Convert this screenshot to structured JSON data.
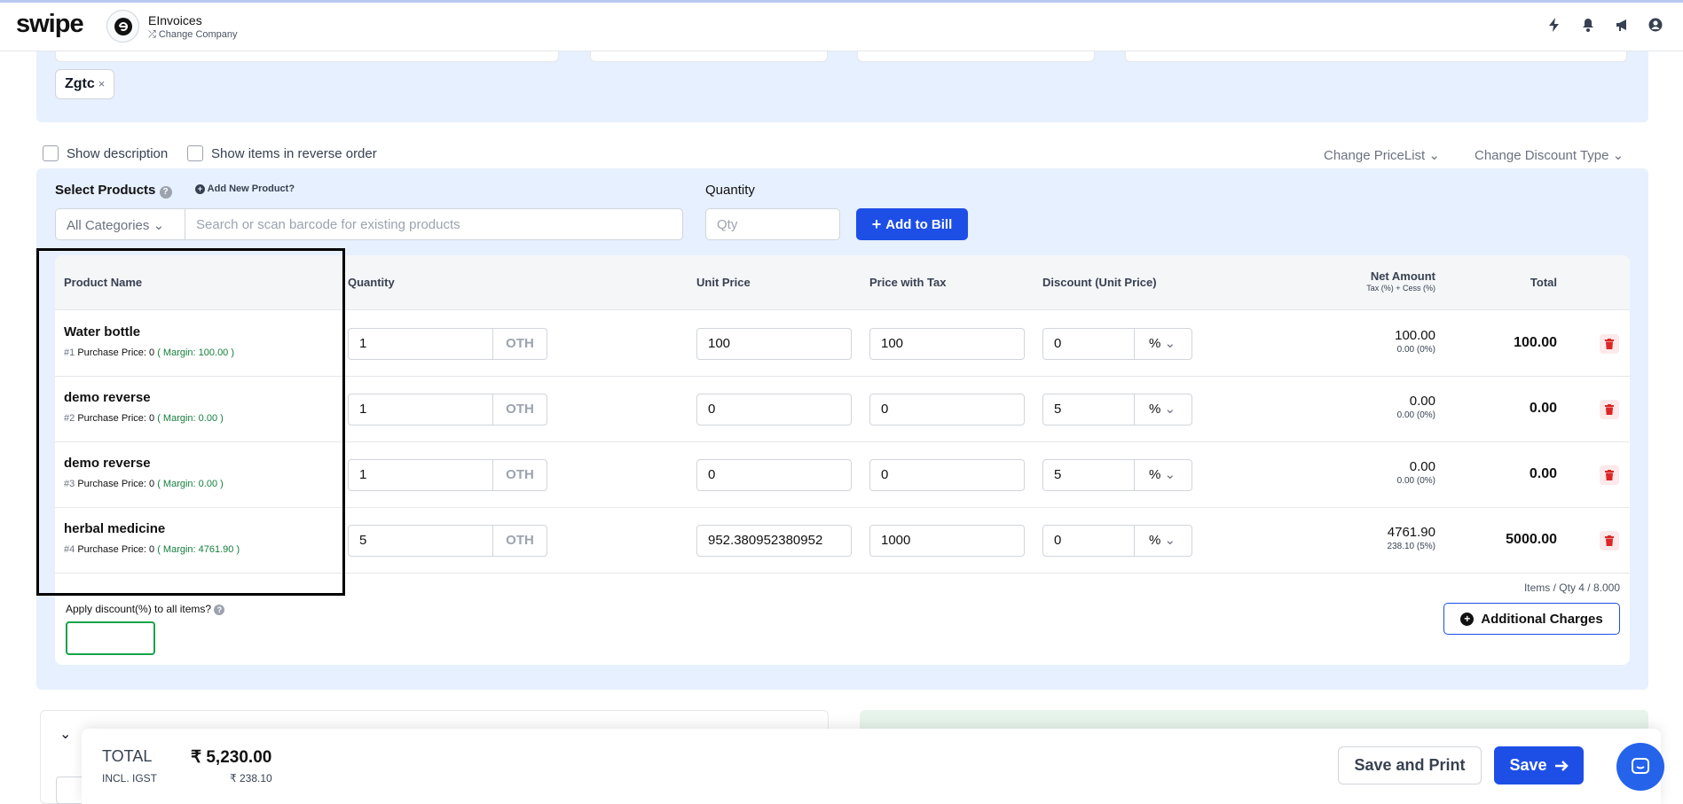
{
  "app": {
    "logo": "swipe",
    "company_name": "EInvoices",
    "change_company": "Change Company"
  },
  "tag": {
    "label": "Zgtc",
    "remove": "×"
  },
  "options": {
    "show_description": "Show description",
    "reverse_order": "Show items in reverse order",
    "change_pricelist": "Change PriceList",
    "change_discount_type": "Change Discount Type"
  },
  "product_select": {
    "label": "Select Products",
    "add_new": "Add New Product?",
    "category": "All Categories",
    "search_placeholder": "Search or scan barcode for existing products",
    "quantity_label": "Quantity",
    "qty_placeholder": "Qty",
    "add_button": "Add to Bill"
  },
  "table": {
    "headers": {
      "product": "Product Name",
      "quantity": "Quantity",
      "unit_price": "Unit Price",
      "price_tax": "Price with Tax",
      "discount": "Discount (Unit Price)",
      "net": "Net Amount",
      "net_sub": "Tax (%) + Cess (%)",
      "total": "Total"
    },
    "rows": [
      {
        "name": "Water bottle",
        "idx": "#1",
        "purchase": "Purchase Price: 0",
        "margin": "( Margin: 100.00 )",
        "qty": "1",
        "unit": "OTH",
        "unit_price": "100",
        "price_tax": "100",
        "discount": "0",
        "disc_type": "%",
        "net": "100.00",
        "tax": "0.00 (0%)",
        "total": "100.00"
      },
      {
        "name": "demo reverse",
        "idx": "#2",
        "purchase": "Purchase Price: 0",
        "margin": "( Margin: 0.00 )",
        "qty": "1",
        "unit": "OTH",
        "unit_price": "0",
        "price_tax": "0",
        "discount": "5",
        "disc_type": "%",
        "net": "0.00",
        "tax": "0.00 (0%)",
        "total": "0.00"
      },
      {
        "name": "demo reverse",
        "idx": "#3",
        "purchase": "Purchase Price: 0",
        "margin": "( Margin: 0.00 )",
        "qty": "1",
        "unit": "OTH",
        "unit_price": "0",
        "price_tax": "0",
        "discount": "5",
        "disc_type": "%",
        "net": "0.00",
        "tax": "0.00 (0%)",
        "total": "0.00"
      },
      {
        "name": "herbal medicine",
        "idx": "#4",
        "purchase": "Purchase Price: 0",
        "margin": "( Margin: 4761.90 )",
        "qty": "5",
        "unit": "OTH",
        "unit_price": "952.380952380952",
        "price_tax": "1000",
        "discount": "0",
        "disc_type": "%",
        "net": "4761.90",
        "tax": "238.10 (5%)",
        "total": "5000.00"
      }
    ],
    "items_qty": "Items / Qty 4 / 8.000"
  },
  "discount_all": {
    "label": "Apply discount(%) to all items?"
  },
  "additional_charges": "Additional Charges",
  "footer": {
    "total_label": "TOTAL",
    "total_value": "₹ 5,230.00",
    "igst_label": "INCL. IGST",
    "igst_value": "₹ 238.10",
    "save_print": "Save and Print",
    "save": "Save"
  },
  "colors": {
    "primary": "#1d4fe6",
    "panel": "#e7f0fe",
    "margin_green": "#15803d",
    "delete_red": "#dc2626"
  },
  "icons": [
    "company-logo-icon",
    "shuffle-icon",
    "lightning-icon",
    "bell-icon",
    "megaphone-icon",
    "user-icon",
    "help-icon",
    "plus-circle-icon",
    "chevron-down-icon",
    "trash-icon",
    "arrow-right-icon",
    "chat-icon"
  ]
}
